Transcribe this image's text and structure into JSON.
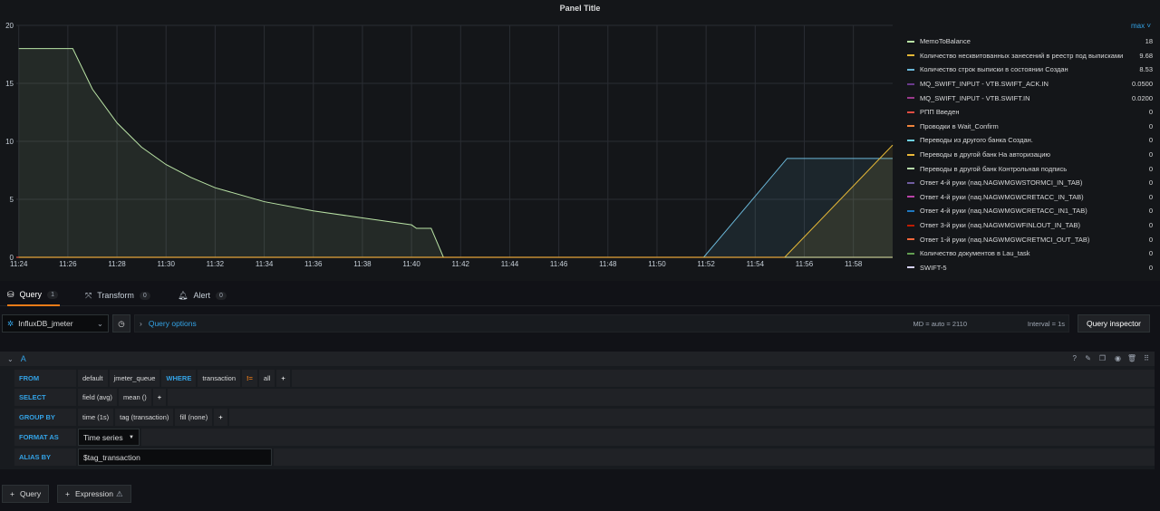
{
  "panel": {
    "title": "Panel Title"
  },
  "legend": {
    "header": "max",
    "items": [
      {
        "name": "MemoToBalance",
        "value": "18",
        "color": "#b9e3a5"
      },
      {
        "name": "Количество несквитованных занесений в реестр под выписками",
        "value": "9.68",
        "color": "#e5b837"
      },
      {
        "name": "Количество строк выписки в состоянии Создан",
        "value": "8.53",
        "color": "#6ab7d8"
      },
      {
        "name": "MQ_SWIFT_INPUT - VTB.SWIFT_ACK.IN",
        "value": "0.0500",
        "color": "#6a3a8c"
      },
      {
        "name": "MQ_SWIFT_INPUT - VTB.SWIFT.IN",
        "value": "0.0200",
        "color": "#9a3a8c"
      },
      {
        "name": "РПП Введен",
        "value": "0",
        "color": "#e24d42"
      },
      {
        "name": "Проводки в Wait_Confirm",
        "value": "0",
        "color": "#ef843c"
      },
      {
        "name": "Переводы из другого банка Создан.",
        "value": "0",
        "color": "#6ed0e0"
      },
      {
        "name": "Переводы в другой банк На авторизацию",
        "value": "0",
        "color": "#eab839"
      },
      {
        "name": "Переводы в другой банк Контрольная подпись",
        "value": "0",
        "color": "#b7dbab"
      },
      {
        "name": "Ответ 4-й руки (naq.NAGWMGWSTORMCI_IN_TAB)",
        "value": "0",
        "color": "#705da0"
      },
      {
        "name": "Ответ 4-й руки (naq.NAGWMGWCRETACC_IN_TAB)",
        "value": "0",
        "color": "#ba43a9"
      },
      {
        "name": "Ответ 4-й руки (naq.NAGWMGWCRETACC_IN1_TAB)",
        "value": "0",
        "color": "#1f78c1"
      },
      {
        "name": "Ответ 3-й руки (naq.NAGWMGWFINLOUT_IN_TAB)",
        "value": "0",
        "color": "#bf1b00"
      },
      {
        "name": "Ответ 1-й руки (naq.NAGWMGWCRETMCI_OUT_TAB)",
        "value": "0",
        "color": "#f4683c"
      },
      {
        "name": "Количество документов в Lau_task",
        "value": "0",
        "color": "#629e51"
      },
      {
        "name": "SWIFT-5",
        "value": "0",
        "color": "#d6d2f8"
      }
    ]
  },
  "chart_data": {
    "type": "line",
    "x_ticks": [
      "11:24",
      "11:26",
      "11:28",
      "11:30",
      "11:32",
      "11:34",
      "11:36",
      "11:38",
      "11:40",
      "11:42",
      "11:44",
      "11:46",
      "11:48",
      "11:50",
      "11:52",
      "11:54",
      "11:56",
      "11:58"
    ],
    "y_ticks": [
      "0",
      "5",
      "10",
      "15",
      "20"
    ],
    "xlim": [
      "11:23.9",
      "11:59.5"
    ],
    "ylim": [
      0,
      20
    ],
    "series": [
      {
        "name": "MemoToBalance",
        "color": "#b9e3a5",
        "x": [
          0,
          2.2,
          3,
          4,
          5,
          6,
          7,
          8,
          10,
          12,
          14,
          16,
          16.2,
          16.8,
          17.3,
          18.7,
          35.6
        ],
        "y": [
          18,
          18,
          14.5,
          11.6,
          9.5,
          8.0,
          6.9,
          6.0,
          4.8,
          4.0,
          3.4,
          2.8,
          2.5,
          2.5,
          0,
          0,
          0
        ]
      },
      {
        "name": "Количество строк выписки в состоянии Создан",
        "color": "#6ab7d8",
        "x": [
          0,
          27.9,
          31.3,
          35.6
        ],
        "y": [
          0,
          0,
          8.53,
          8.53
        ]
      },
      {
        "name": "Количество несквитованных занесений в реестр под выписками",
        "color": "#e5b837",
        "x": [
          0,
          31.2,
          35.6
        ],
        "y": [
          0,
          0,
          9.68
        ]
      }
    ]
  },
  "tabs": [
    {
      "label": "Query",
      "badge": "1"
    },
    {
      "label": "Transform",
      "badge": "0"
    },
    {
      "label": "Alert",
      "badge": "0"
    }
  ],
  "toolbar": {
    "datasource": "InfluxDB_jmeter",
    "query_options": "Query options",
    "md_info": "MD = auto = 2110",
    "interval_info": "Interval = 1s",
    "inspector": "Query inspector"
  },
  "query": {
    "ref": "A",
    "from_label": "FROM",
    "from_policy": "default",
    "from_measurement": "jmeter_queue",
    "where_label": "WHERE",
    "where_key": "transaction",
    "where_op": "!=",
    "where_value": "all",
    "select_label": "SELECT",
    "select_field": "field (avg)",
    "select_fn": "mean ()",
    "group_label": "GROUP BY",
    "group_time": "time (1s)",
    "group_tag": "tag (transaction)",
    "group_fill": "fill (none)",
    "format_label": "FORMAT AS",
    "format_value": "Time series",
    "alias_label": "ALIAS BY",
    "alias_value": "$tag_transaction",
    "plus": "+"
  },
  "buttons": {
    "add_query": "Query",
    "add_expression": "Expression"
  }
}
